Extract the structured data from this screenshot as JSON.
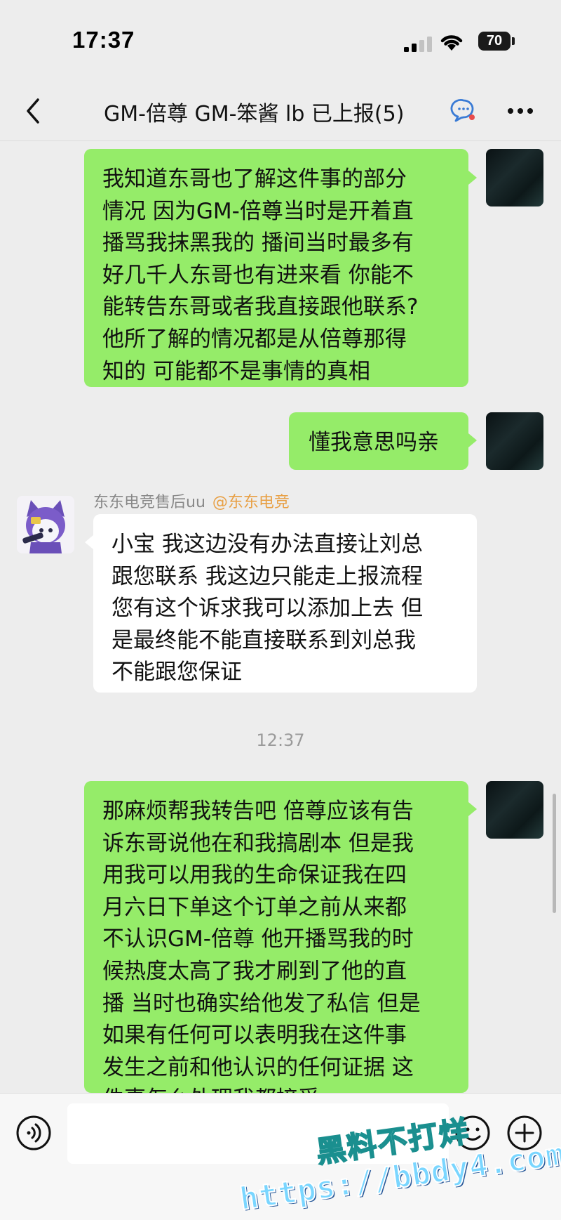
{
  "status_bar": {
    "time": "17:37",
    "battery": "70"
  },
  "header": {
    "title": "GM-倍尊 GM-笨酱 lb 已上报(5)"
  },
  "messages": [
    {
      "side": "right",
      "text": "我知道东哥也了解这件事的部分\n情况 因为GM-倍尊当时是开着直\n播骂我抹黑我的 播间当时最多有\n好几千人东哥也有进来看 你能不\n能转告东哥或者我直接跟他联系?\n他所了解的情况都是从倍尊那得\n知的 可能都不是事情的真相"
    },
    {
      "side": "right",
      "text": "懂我意思吗亲"
    },
    {
      "side": "left",
      "sender": "东东电竞售后uu",
      "sender_tag": "@东东电竞",
      "text": "小宝 我这边没有办法直接让刘总\n跟您联系 我这边只能走上报流程\n您有这个诉求我可以添加上去 但\n是最终能不能直接联系到刘总我\n不能跟您保证"
    },
    {
      "side": "right",
      "text": "那麻烦帮我转告吧 倍尊应该有告\n诉东哥说他在和我搞剧本 但是我\n用我可以用我的生命保证我在四\n月六日下单这个订单之前从来都\n不认识GM-倍尊 他开播骂我的时\n候热度太高了我才刷到了他的直\n播 当时也确实给他发了私信 但是\n如果有任何可以表明我在这件事\n发生之前和他认识的任何证据 这\n件事怎么处理我都接受"
    }
  ],
  "time_separator": "12:37",
  "input": {
    "value": ""
  },
  "watermark": {
    "line1": "黑料不打烊",
    "line2": "https://bbdy4.com"
  }
}
